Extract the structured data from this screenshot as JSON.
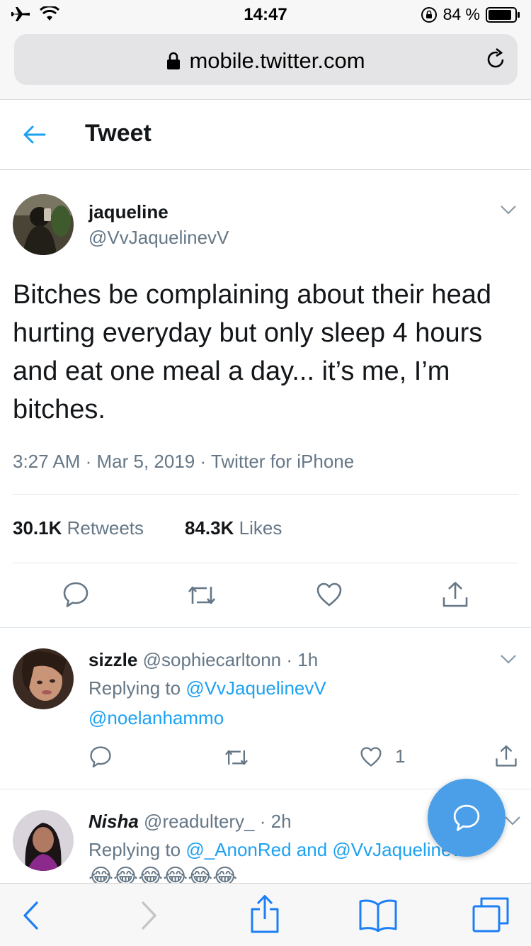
{
  "status_bar": {
    "time": "14:47",
    "battery": "84 %"
  },
  "browser": {
    "url": "mobile.twitter.com"
  },
  "header": {
    "title": "Tweet"
  },
  "tweet": {
    "name": "jaqueline",
    "handle": "@VvJaquelinevV",
    "text": "Bitches be complaining about their head hurting everyday but only sleep 4 hours and eat one meal a day... it’s me, I’m bitches.",
    "meta": "3:27 AM · Mar 5, 2019 · Twitter for iPhone",
    "retweets_count": "30.1K",
    "retweets_label": "Retweets",
    "likes_count": "84.3K",
    "likes_label": "Likes"
  },
  "replies": [
    {
      "name": "sizzle",
      "handle": "@sophiecarltonn",
      "time": "· 1h",
      "replying_prefix": "Replying to",
      "replying_to": "@VvJaquelinevV",
      "text": "@noelanhammo",
      "like_count": "1"
    },
    {
      "name": "Nisha",
      "handle": "@readultery_",
      "time": "· 2h",
      "replying_prefix": "Replying to",
      "replying_to": "@_AnonRed and @VvJaquelinevV",
      "emoji": "😂😂😂😂😂😂"
    }
  ],
  "colors": {
    "accent": "#1da1f2",
    "fab": "#4a9fe8",
    "muted": "#657786",
    "text": "#14171a"
  }
}
